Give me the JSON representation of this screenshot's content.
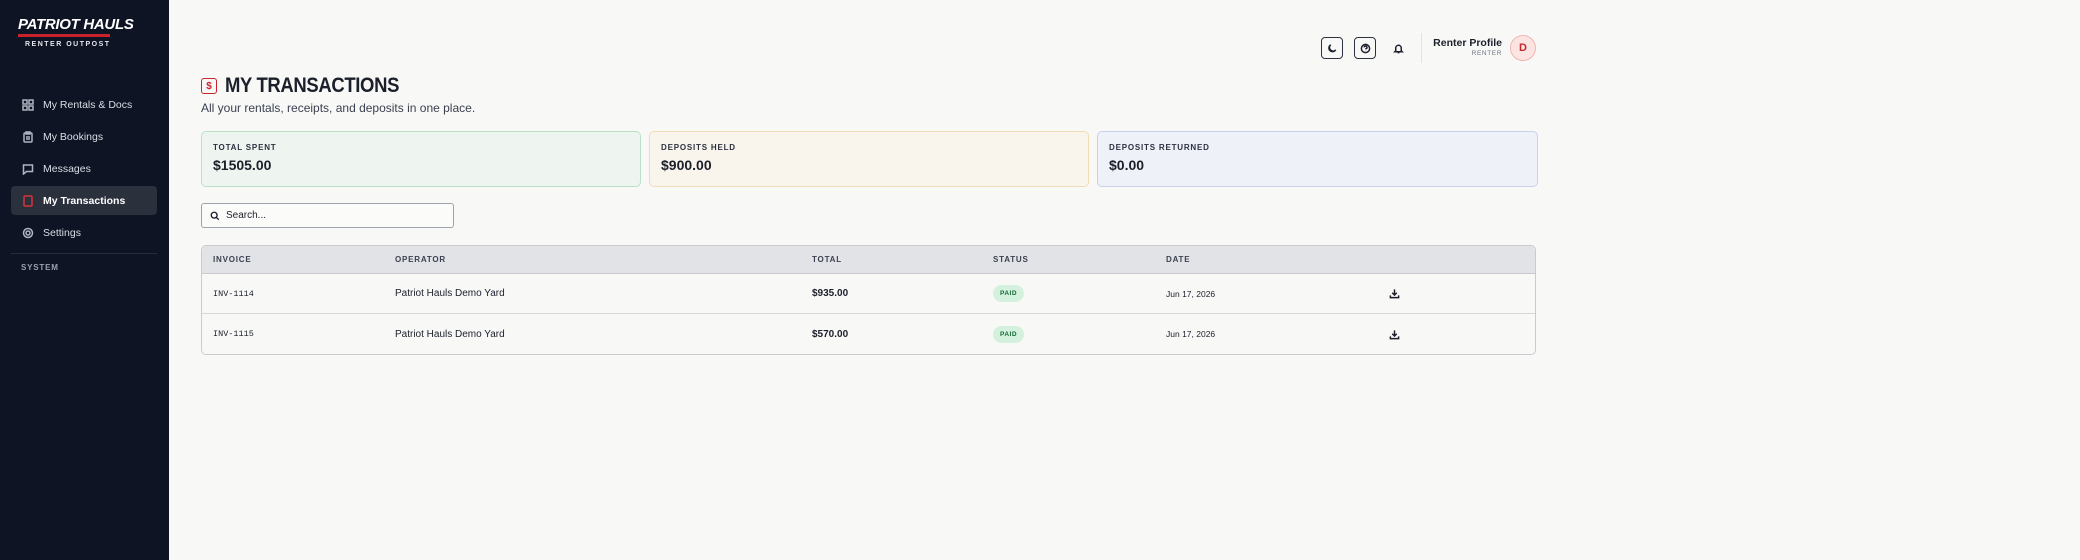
{
  "brand": {
    "name": "PATRIOT HAULS",
    "subtitle": "RENTER OUTPOST"
  },
  "sidebar": {
    "items": [
      {
        "label": "My Rentals & Docs",
        "icon": "grid-icon",
        "active": false
      },
      {
        "label": "My Bookings",
        "icon": "clipboard-icon",
        "active": false
      },
      {
        "label": "Messages",
        "icon": "chat-icon",
        "active": false
      },
      {
        "label": "My Transactions",
        "icon": "receipt-icon",
        "active": true
      },
      {
        "label": "Settings",
        "icon": "gear-icon",
        "active": false
      }
    ],
    "section_label": "SYSTEM"
  },
  "header": {
    "profile_name": "Renter Profile",
    "profile_role": "RENTER",
    "avatar_initial": "D"
  },
  "page": {
    "title": "MY TRANSACTIONS",
    "title_icon": "$",
    "subtitle": "All your rentals, receipts, and deposits in one place."
  },
  "stats": [
    {
      "label": "TOTAL SPENT",
      "value": "$1505.00",
      "color": "#eef5f0"
    },
    {
      "label": "DEPOSITS HELD",
      "value": "$900.00",
      "color": "#f9f5ec"
    },
    {
      "label": "DEPOSITS RETURNED",
      "value": "$0.00",
      "color": "#eff1f8"
    }
  ],
  "search": {
    "placeholder": "Search...",
    "value": ""
  },
  "table": {
    "columns": [
      "INVOICE",
      "OPERATOR",
      "TOTAL",
      "STATUS",
      "DATE"
    ],
    "rows": [
      {
        "invoice": "INV-1114",
        "operator": "Patriot Hauls Demo Yard",
        "total": "$935.00",
        "status": "PAID",
        "date": "Jun 17, 2026"
      },
      {
        "invoice": "INV-1115",
        "operator": "Patriot Hauls Demo Yard",
        "total": "$570.00",
        "status": "PAID",
        "date": "Jun 17, 2026"
      }
    ]
  },
  "colors": {
    "sidebar_bg": "#0e1424",
    "accent": "#c8222b",
    "paid_badge": "#d3f1dc"
  }
}
